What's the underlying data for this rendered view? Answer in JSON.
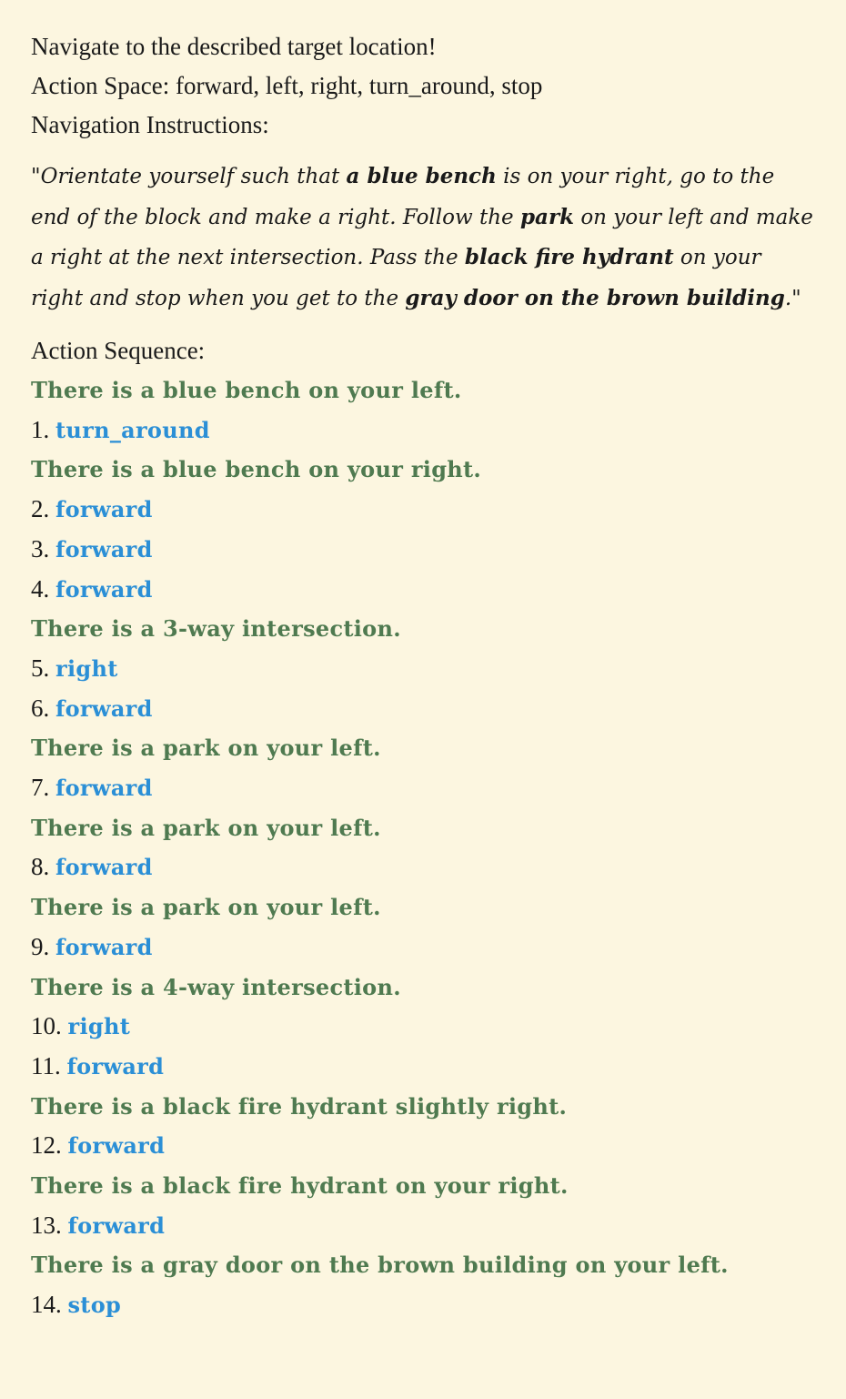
{
  "intro": "Navigate to the described target location!",
  "action_space": "Action Space: forward, left, right, turn_around, stop",
  "nav_label": "Navigation Instructions:",
  "instruction": {
    "open_quote": "\"",
    "p1": "Orientate yourself such that ",
    "b1": "a blue bench",
    "p2": " is on your right, go to the end of the block and make a right. Follow the ",
    "b2": "park",
    "p3": " on your left and make a right at the next intersection. Pass the ",
    "b3": "black fire hydrant",
    "p4": " on your right and stop when you get to the ",
    "b4": "gray door on the brown building",
    "p5": ".",
    "close_quote": "\""
  },
  "seq_label": "Action Sequence:",
  "sequence": [
    {
      "type": "obs",
      "text": "There is a blue bench on your left."
    },
    {
      "type": "act",
      "num": "1.",
      "action": "turn_around"
    },
    {
      "type": "obs",
      "text": "There is a blue bench on your right."
    },
    {
      "type": "act",
      "num": "2.",
      "action": "forward"
    },
    {
      "type": "act",
      "num": "3.",
      "action": "forward"
    },
    {
      "type": "act",
      "num": "4.",
      "action": "forward"
    },
    {
      "type": "obs",
      "text": "There is a 3-way intersection."
    },
    {
      "type": "act",
      "num": "5.",
      "action": "right"
    },
    {
      "type": "act",
      "num": "6.",
      "action": "forward"
    },
    {
      "type": "obs",
      "text": "There is a park on your left."
    },
    {
      "type": "act",
      "num": "7.",
      "action": "forward"
    },
    {
      "type": "obs",
      "text": "There is a park on your left."
    },
    {
      "type": "act",
      "num": "8.",
      "action": "forward"
    },
    {
      "type": "obs",
      "text": "There is a park on your left."
    },
    {
      "type": "act",
      "num": "9.",
      "action": "forward"
    },
    {
      "type": "obs",
      "text": "There is a 4-way intersection."
    },
    {
      "type": "act",
      "num": "10.",
      "action": "right"
    },
    {
      "type": "act",
      "num": "11.",
      "action": "forward"
    },
    {
      "type": "obs",
      "text": "There is a black fire hydrant slightly right."
    },
    {
      "type": "act",
      "num": "12.",
      "action": "forward"
    },
    {
      "type": "obs",
      "text": "There is a black fire hydrant on your right."
    },
    {
      "type": "act",
      "num": "13.",
      "action": "forward"
    },
    {
      "type": "obs",
      "text": "There is a gray door on the brown building on your left."
    },
    {
      "type": "act",
      "num": "14.",
      "action": "stop"
    }
  ],
  "colors": {
    "background": "#fcf6e0",
    "observation": "#4f7a50",
    "action": "#2b8fd6",
    "text": "#1a1a1a"
  }
}
